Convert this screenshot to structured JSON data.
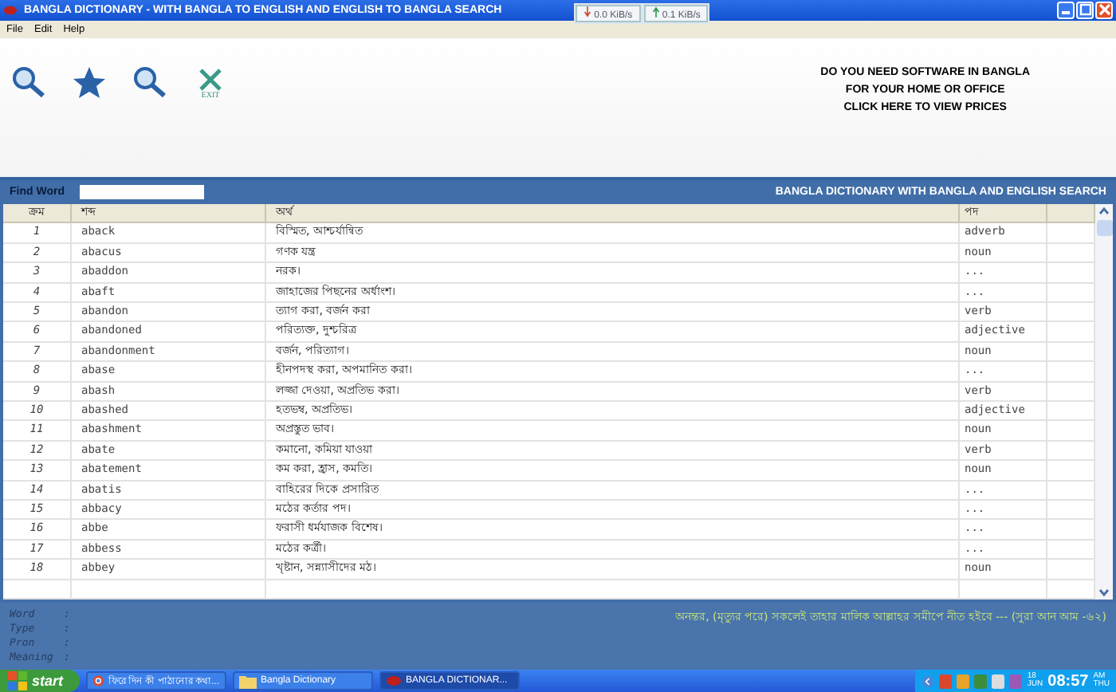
{
  "window": {
    "title": "BANGLA DICTIONARY - WITH BANGLA TO ENGLISH AND ENGLISH TO BANGLA SEARCH"
  },
  "net_meter": {
    "download": "0.0 KiB/s",
    "upload": "0.1 KiB/s"
  },
  "menu": [
    "File",
    "Edit",
    "Help"
  ],
  "toolbar": {
    "exit_label": "EXIT",
    "promo": [
      "DO YOU NEED SOFTWARE IN BANGLA",
      "FOR YOUR HOME OR OFFICE",
      "CLICK HERE TO VIEW PRICES"
    ]
  },
  "search": {
    "label": "Find Word",
    "banner": "BANGLA DICTIONARY WITH BANGLA AND ENGLISH SEARCH"
  },
  "table": {
    "columns": [
      "ক্রম",
      "শব্দ",
      "অর্থ",
      "পদ"
    ],
    "rows": [
      {
        "no": "1",
        "word": "aback",
        "meaning": "বিস্মিত, আশ্চর্যান্বিত",
        "pos": "adverb"
      },
      {
        "no": "2",
        "word": "abacus",
        "meaning": "গণক যন্ত্র",
        "pos": "noun"
      },
      {
        "no": "3",
        "word": "abaddon",
        "meaning": "নরক।",
        "pos": "..."
      },
      {
        "no": "4",
        "word": "abaft",
        "meaning": "জাহাজের পিছনের অর্ধাংশ।",
        "pos": "..."
      },
      {
        "no": "5",
        "word": "abandon",
        "meaning": "ত্যাগ করা, বর্জন করা",
        "pos": "verb"
      },
      {
        "no": "6",
        "word": "abandoned",
        "meaning": "পরিত্যক্ত, দুশ্চরিত্র",
        "pos": "adjective"
      },
      {
        "no": "7",
        "word": "abandonment",
        "meaning": "বর্জন, পরিত্যাগ।",
        "pos": "noun"
      },
      {
        "no": "8",
        "word": "abase",
        "meaning": "হীনপদস্থ করা, অপমানিত করা।",
        "pos": "..."
      },
      {
        "no": "9",
        "word": "abash",
        "meaning": "লজ্জা দেওয়া, অপ্রতিভ করা।",
        "pos": "verb"
      },
      {
        "no": "10",
        "word": "abashed",
        "meaning": "হতভম্ব, অপ্রতিভ।",
        "pos": "adjective"
      },
      {
        "no": "11",
        "word": "abashment",
        "meaning": "অপ্রস্তুত ভাব।",
        "pos": "noun"
      },
      {
        "no": "12",
        "word": "abate",
        "meaning": "কমানো, কমিয়া যাওয়া",
        "pos": "verb"
      },
      {
        "no": "13",
        "word": "abatement",
        "meaning": "কম করা, হ্রাস, কমতি।",
        "pos": "noun"
      },
      {
        "no": "14",
        "word": "abatis",
        "meaning": "বাহিরের দিকে প্রসারিত",
        "pos": "..."
      },
      {
        "no": "15",
        "word": "abbacy",
        "meaning": "মঠের কর্তার পদ।",
        "pos": "..."
      },
      {
        "no": "16",
        "word": "abbe",
        "meaning": "ফরাসী ধর্মযাজক বিশেষ।",
        "pos": "..."
      },
      {
        "no": "17",
        "word": "abbess",
        "meaning": "মঠের কর্ত্রী।",
        "pos": "..."
      },
      {
        "no": "18",
        "word": "abbey",
        "meaning": "খৃষ্টান, সন্ন্যাসীদের মঠ।",
        "pos": "noun"
      }
    ]
  },
  "details": {
    "fields": [
      "Word",
      "Type",
      "Pron",
      "Meaning"
    ],
    "separator": ":",
    "quote": "অনন্তর, (মৃত্যুর পরে) সকলেই তাহার মালিক আল্লাহর সমীপে নীত হইবে --- (সুরা আন আম -৬২)"
  },
  "taskbar": {
    "start": "start",
    "tasks": [
      {
        "label": "ফিরে দিন কী পাঠানোর কথা...",
        "kind": "browser",
        "selected": false
      },
      {
        "label": "Bangla Dictionary",
        "kind": "folder",
        "selected": false
      },
      {
        "label": "BANGLA DICTIONAR...",
        "kind": "app",
        "selected": true
      }
    ],
    "date_day": "18",
    "date_month": "JUN",
    "time": "08:57",
    "ampm": "AM",
    "weekday": "THU"
  }
}
